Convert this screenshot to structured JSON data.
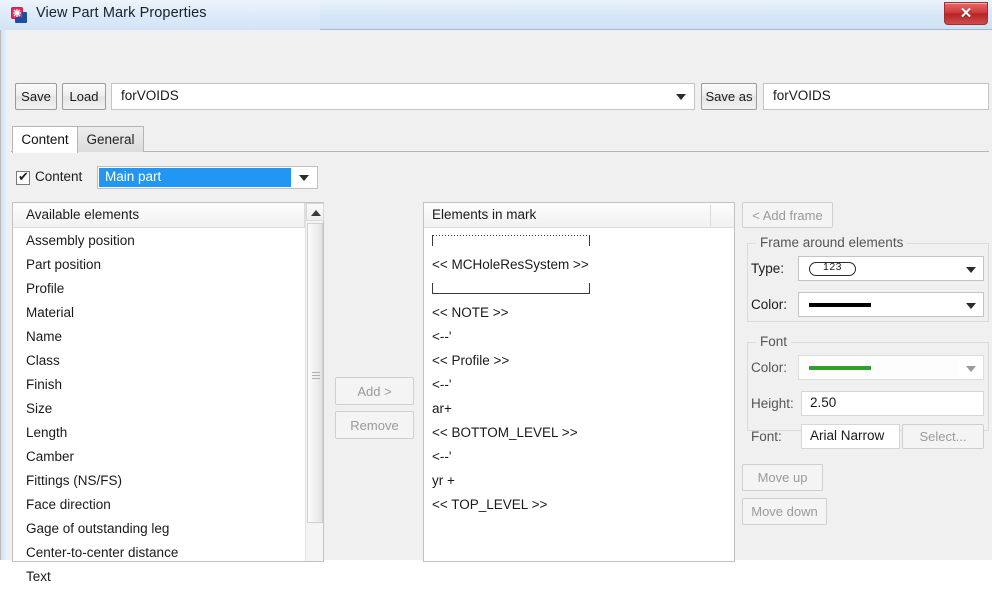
{
  "window": {
    "title": "View Part Mark Properties",
    "app_icon": "tekla-icon",
    "close_label": "✕"
  },
  "toolbar": {
    "save_label": "Save",
    "load_label": "Load",
    "name_value": "forVOIDS",
    "save_as_label": "Save as",
    "save_as_value": "forVOIDS"
  },
  "tabs": [
    {
      "label": "Content",
      "active": true
    },
    {
      "label": "General",
      "active": false
    }
  ],
  "content_row": {
    "checkbox_checked": true,
    "checkbox_tick": "✔",
    "label": "Content",
    "combo_value": "Main part",
    "combo_selected_color": "#2196f3"
  },
  "available": {
    "header": "Available elements",
    "items": [
      "Assembly position",
      "Part position",
      "Profile",
      "Material",
      "Name",
      "Class",
      "Finish",
      "Size",
      "Length",
      "Camber",
      "Fittings (NS/FS)",
      "Face direction",
      "Gage of outstanding leg",
      "Center-to-center distance",
      "Text"
    ]
  },
  "transfer": {
    "add_label": "Add >",
    "remove_label": "Remove"
  },
  "mark": {
    "header": "Elements in mark",
    "items": [
      {
        "type": "frame-top",
        "label": ""
      },
      {
        "type": "text",
        "label": "<< MCHoleResSystem >>"
      },
      {
        "type": "frame-bottom",
        "label": ""
      },
      {
        "type": "text",
        "label": "<< NOTE >>"
      },
      {
        "type": "text",
        "label": "<--'"
      },
      {
        "type": "text",
        "label": "<< Profile >>"
      },
      {
        "type": "text",
        "label": "<--'"
      },
      {
        "type": "text",
        "label": "ar+"
      },
      {
        "type": "text",
        "label": "<< BOTTOM_LEVEL >>"
      },
      {
        "type": "text",
        "label": "<--'"
      },
      {
        "type": "text",
        "label": "yr +"
      },
      {
        "type": "text",
        "label": "<< TOP_LEVEL >>"
      }
    ]
  },
  "right_panel": {
    "add_frame_label": "< Add frame",
    "frame_group": {
      "legend": "Frame around elements",
      "type_label": "Type:",
      "type_value": "123",
      "color_label": "Color:",
      "color_value": "#000000"
    },
    "font_group": {
      "legend": "Font",
      "color_label": "Color:",
      "color_value": "#2e9e2e",
      "height_label": "Height:",
      "height_value": "2.50",
      "font_label": "Font:",
      "font_value": "Arial Narrow",
      "select_label": "Select..."
    },
    "move_up_label": "Move up",
    "move_down_label": "Move down"
  }
}
